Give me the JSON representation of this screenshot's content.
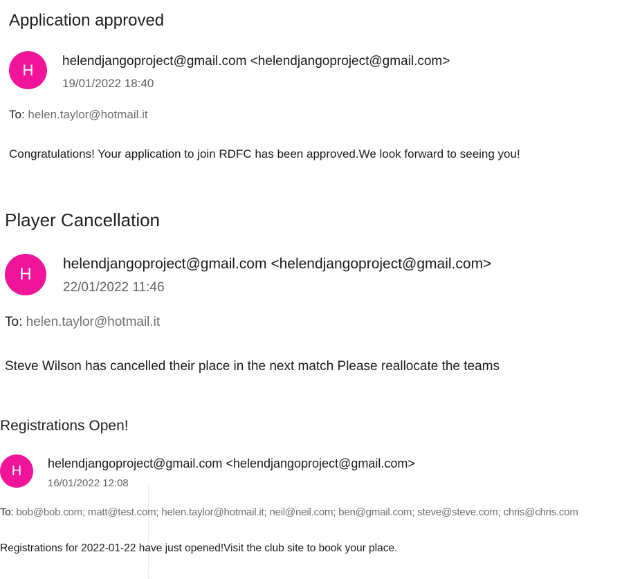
{
  "emails": [
    {
      "subject": "Application approved",
      "avatar_initial": "H",
      "sender": "helendjangoproject@gmail.com <helendjangoproject@gmail.com>",
      "date": "19/01/2022 18:40",
      "to_label": "To:",
      "recipients": "helen.taylor@hotmail.it",
      "body": "Congratulations! Your application to join RDFC has been approved.We look forward to seeing you!"
    },
    {
      "subject": "Player Cancellation",
      "avatar_initial": "H",
      "sender": "helendjangoproject@gmail.com <helendjangoproject@gmail.com>",
      "date": "22/01/2022 11:46",
      "to_label": "To:",
      "recipients": "helen.taylor@hotmail.it",
      "body": "Steve Wilson has cancelled their place in the next match Please reallocate the teams"
    },
    {
      "subject": "Registrations Open!",
      "avatar_initial": "H",
      "sender": "helendjangoproject@gmail.com <helendjangoproject@gmail.com>",
      "date": "16/01/2022 12:08",
      "to_label": "To:",
      "recipients": "bob@bob.com; matt@test.com; helen.taylor@hotmail.it; neil@neil.com; ben@gmail.com; steve@steve.com; chris@chris.com",
      "body": "Registrations for 2022-01-22 have just opened!Visit the club site to book your place."
    }
  ],
  "colors": {
    "avatar": "#f0149a",
    "recipient_text": "#6e6e6e",
    "date_text": "#606060"
  }
}
